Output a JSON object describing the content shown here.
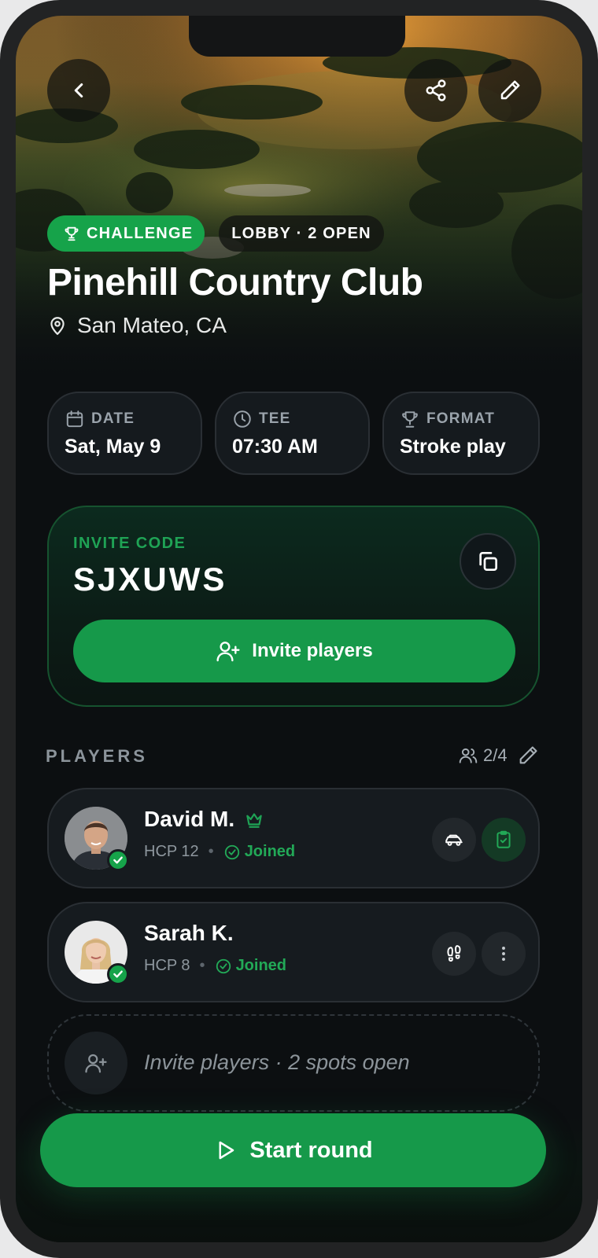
{
  "header": {
    "back_icon": "chevron-left-icon",
    "share_icon": "share-icon",
    "edit_icon": "pencil-icon",
    "badge_challenge": "CHALLENGE",
    "badge_lobby": "LOBBY · 2 OPEN",
    "title": "Pinehill Country Club",
    "location": "San Mateo, CA"
  },
  "info": {
    "date_label": "DATE",
    "date_value": "Sat, May 9",
    "tee_label": "TEE",
    "tee_value": "07:30 AM",
    "format_label": "FORMAT",
    "format_value": "Stroke play"
  },
  "invite": {
    "code_label": "INVITE CODE",
    "code": "SJXUWS",
    "button_label": "Invite players"
  },
  "players": {
    "section_label": "PLAYERS",
    "count": "2/4",
    "list": [
      {
        "name": "David M.",
        "hcp": "HCP 12",
        "status": "Joined",
        "is_host": true,
        "action_icons": [
          "car-icon",
          "clipboard-check-icon"
        ]
      },
      {
        "name": "Sarah K.",
        "hcp": "HCP 8",
        "status": "Joined",
        "is_host": false,
        "action_icons": [
          "footprints-icon",
          "more-vertical-icon"
        ]
      }
    ],
    "invite_row": "Invite players · 2 spots open"
  },
  "footer": {
    "start_label": "Start round"
  },
  "colors": {
    "accent": "#16a34a",
    "background": "#0c0f11",
    "card": "#161b1f"
  }
}
